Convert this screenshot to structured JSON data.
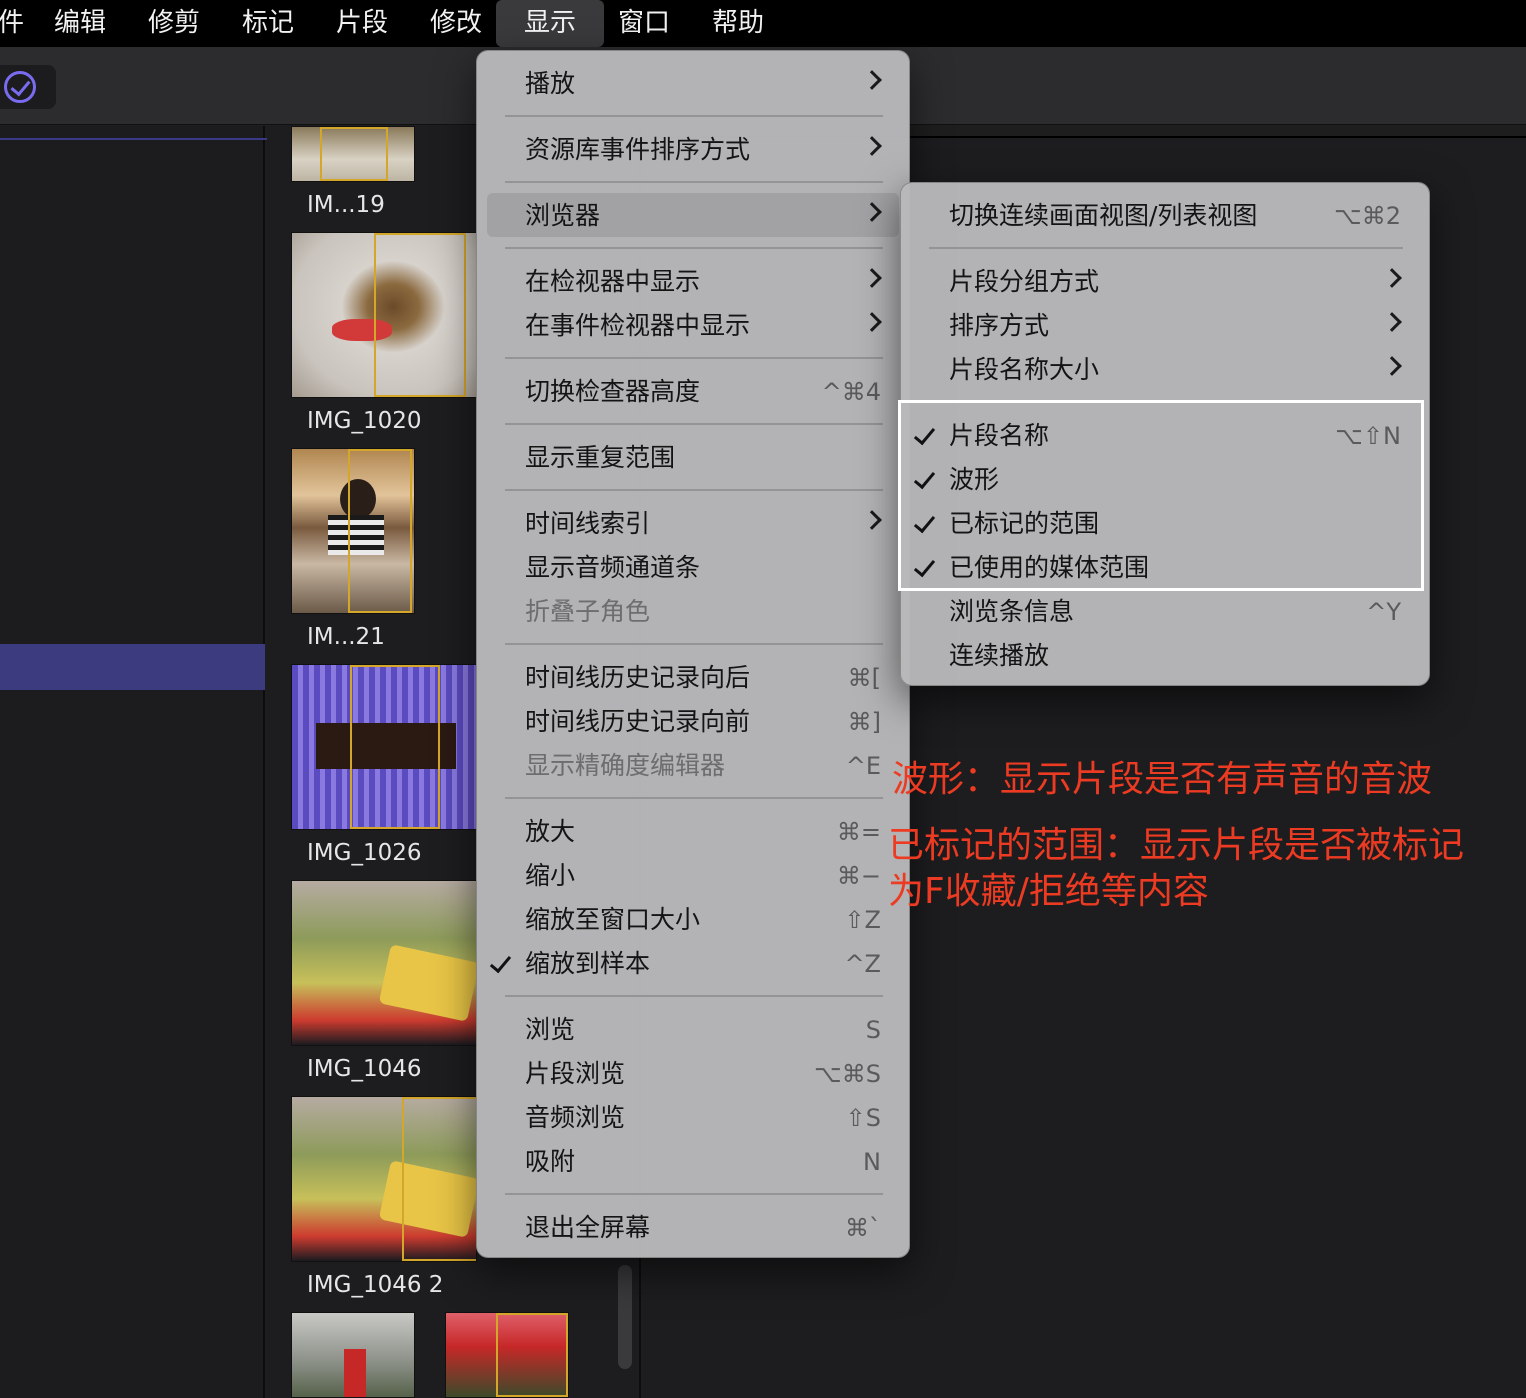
{
  "menubar": {
    "items": [
      {
        "label": "件"
      },
      {
        "label": "编辑"
      },
      {
        "label": "修剪"
      },
      {
        "label": "标记"
      },
      {
        "label": "片段"
      },
      {
        "label": "修改"
      },
      {
        "label": "显示"
      },
      {
        "label": "窗口"
      },
      {
        "label": "帮助"
      }
    ]
  },
  "browser": {
    "clips": [
      {
        "label": "IM...19"
      },
      {
        "label": "IMG_1020"
      },
      {
        "label": "IM...21"
      },
      {
        "label": "IMG_1026"
      },
      {
        "label": "IMG_1046"
      },
      {
        "label": "IMG_1046 2"
      }
    ]
  },
  "view_menu": {
    "items": [
      {
        "label": "播放"
      },
      {
        "label": "资源库事件排序方式"
      },
      {
        "label": "浏览器"
      },
      {
        "label": "在检视器中显示"
      },
      {
        "label": "在事件检视器中显示"
      },
      {
        "label": "切换检查器高度",
        "shortcut": "^⌘4"
      },
      {
        "label": "显示重复范围"
      },
      {
        "label": "时间线索引"
      },
      {
        "label": "显示音频通道条"
      },
      {
        "label": "折叠子角色"
      },
      {
        "label": "时间线历史记录向后",
        "shortcut": "⌘["
      },
      {
        "label": "时间线历史记录向前",
        "shortcut": "⌘]"
      },
      {
        "label": "显示精确度编辑器",
        "shortcut": "^E"
      },
      {
        "label": "放大",
        "shortcut": "⌘="
      },
      {
        "label": "缩小",
        "shortcut": "⌘−"
      },
      {
        "label": "缩放至窗口大小",
        "shortcut": "⇧Z"
      },
      {
        "label": "缩放到样本",
        "shortcut": "^Z"
      },
      {
        "label": "浏览",
        "shortcut": "S"
      },
      {
        "label": "片段浏览",
        "shortcut": "⌥⌘S"
      },
      {
        "label": "音频浏览",
        "shortcut": "⇧S"
      },
      {
        "label": "吸附",
        "shortcut": "N"
      },
      {
        "label": "退出全屏幕",
        "shortcut": "⌘`"
      }
    ]
  },
  "browser_submenu": {
    "items": [
      {
        "label": "切换连续画面视图/列表视图",
        "shortcut": "⌥⌘2"
      },
      {
        "label": "片段分组方式"
      },
      {
        "label": "排序方式"
      },
      {
        "label": "片段名称大小"
      },
      {
        "label": "片段名称",
        "shortcut": "⌥⇧N"
      },
      {
        "label": "波形"
      },
      {
        "label": "已标记的范围"
      },
      {
        "label": "已使用的媒体范围"
      },
      {
        "label": "浏览条信息",
        "shortcut": "^Y"
      },
      {
        "label": "连续播放"
      }
    ]
  },
  "annotations": {
    "line1": "波形：显示片段是否有声音的音波",
    "line2": "已标记的范围：显示片段是否被标记",
    "line3": "为F收藏/拒绝等内容"
  },
  "colors": {
    "annotation_red": "#ec3b22",
    "selection_purple": "#3c3b80",
    "range_yellow": "#d4a62a"
  }
}
